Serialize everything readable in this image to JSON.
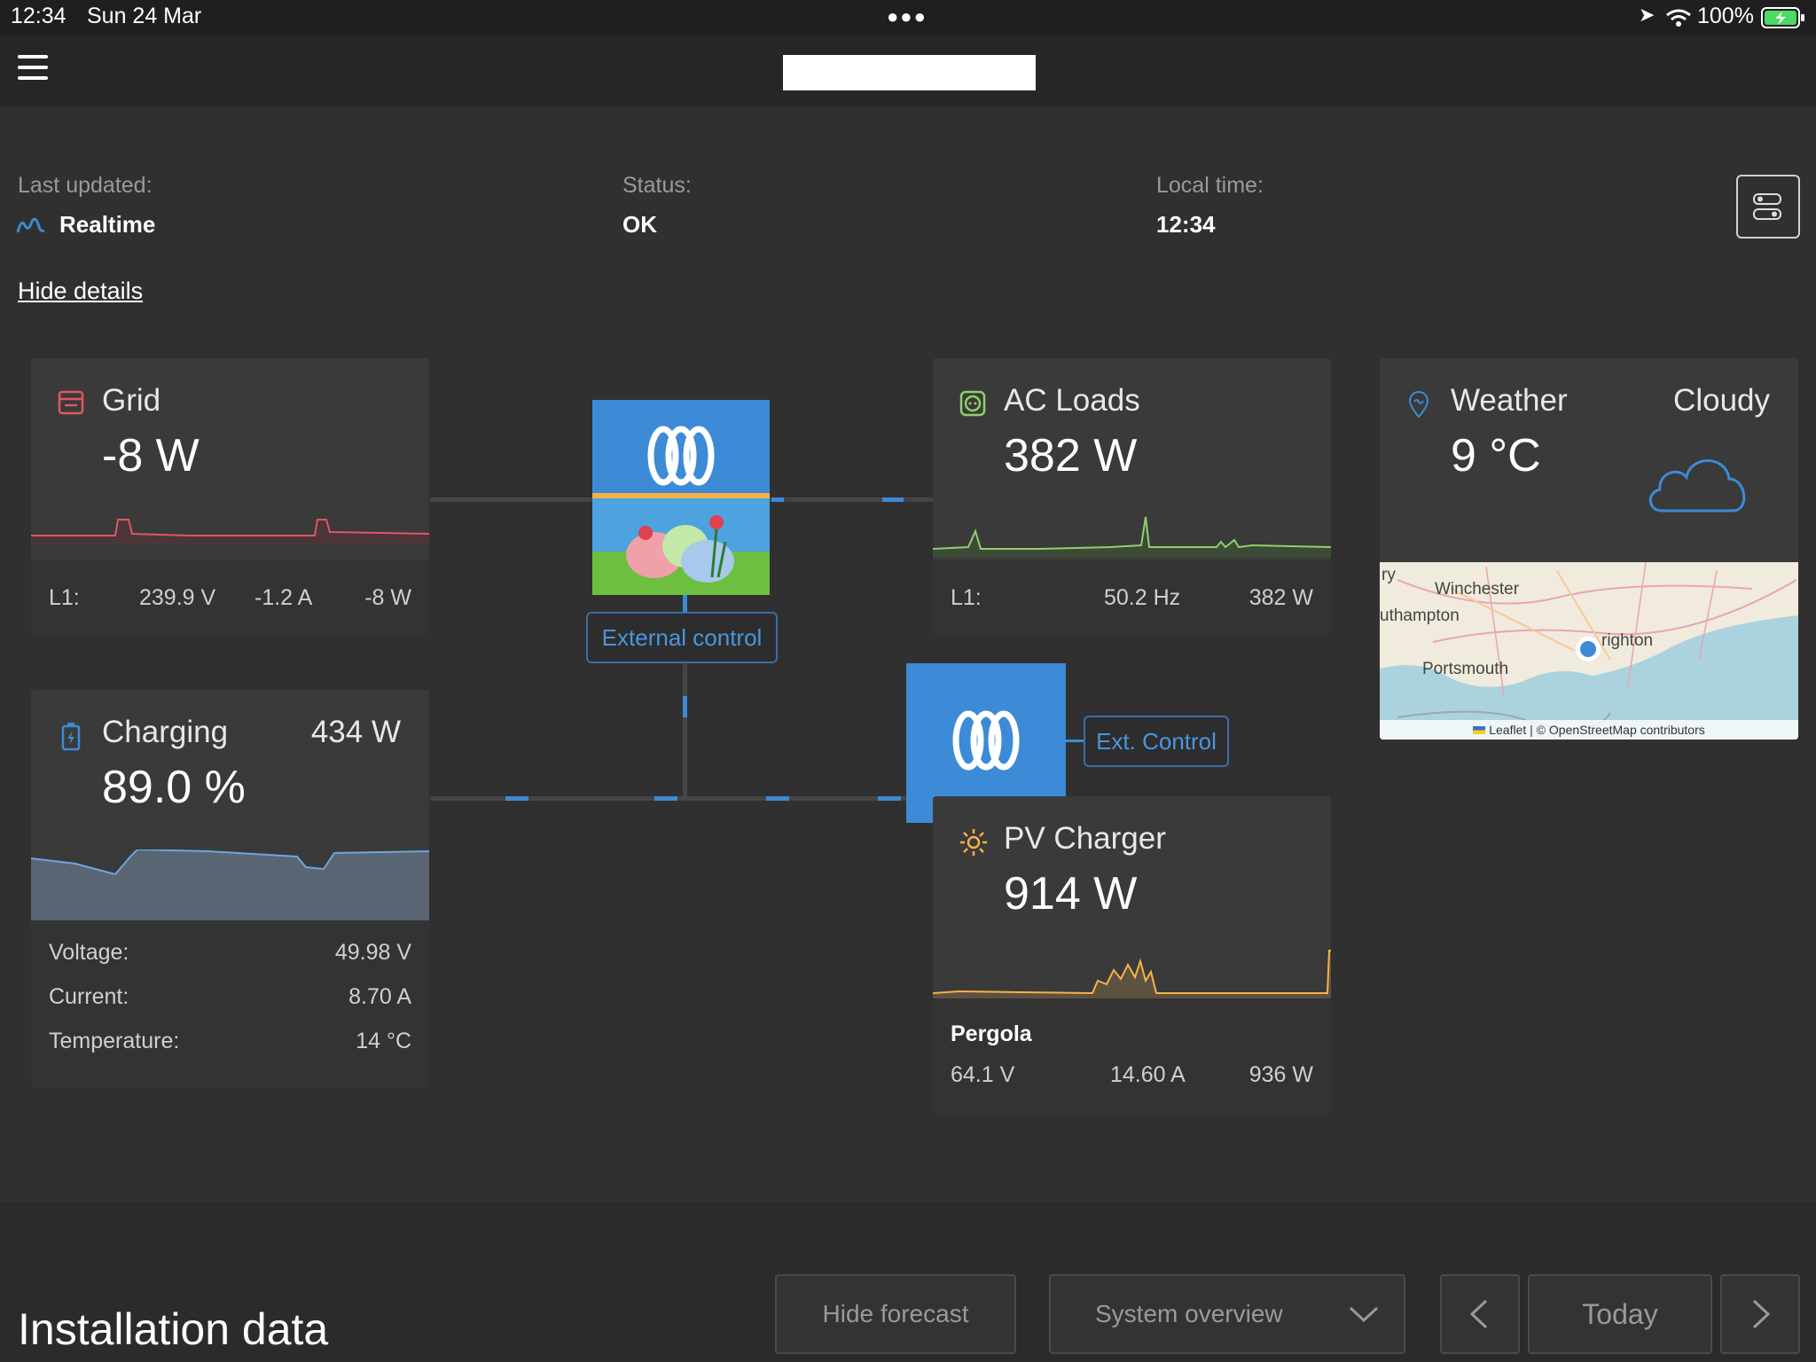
{
  "status_bar": {
    "time": "12:34",
    "date": "Sun 24 Mar",
    "battery": "100%"
  },
  "info": {
    "last_updated_label": "Last updated:",
    "last_updated_value": "Realtime",
    "status_label": "Status:",
    "status_value": "OK",
    "local_time_label": "Local time:",
    "local_time_value": "12:34",
    "hide_details": "Hide details"
  },
  "grid": {
    "title": "Grid",
    "power": "-8 W",
    "phase": "L1:",
    "voltage": "239.9 V",
    "current": "-1.2 A",
    "phase_power": "-8 W",
    "color": "#e0575f"
  },
  "battery": {
    "title": "Charging",
    "power": "434 W",
    "soc": "89.0 %",
    "rows": [
      {
        "label": "Voltage:",
        "value": "49.98 V"
      },
      {
        "label": "Current:",
        "value": "8.70 A"
      },
      {
        "label": "Temperature:",
        "value": "14 °C"
      }
    ]
  },
  "inverter": {
    "ext_label": "External control"
  },
  "ac_loads": {
    "title": "AC Loads",
    "power": "382 W",
    "phase": "L1:",
    "frequency": "50.2 Hz",
    "phase_power": "382 W",
    "color": "#8fd16a"
  },
  "solar_unit": {
    "ext_label": "Ext. Control"
  },
  "pv": {
    "title": "PV Charger",
    "power": "914 W",
    "name": "Pergola",
    "voltage": "64.1 V",
    "current": "14.60 A",
    "array_power": "936 W",
    "color": "#f5b248"
  },
  "weather": {
    "title": "Weather",
    "condition": "Cloudy",
    "temperature": "9 °C",
    "map_labels": [
      "Winchester",
      "uthampton",
      "righton",
      "Portsmouth",
      "ry"
    ],
    "attribution": "Leaflet | © OpenStreetMap contributors"
  },
  "bottom": {
    "heading": "Installation data",
    "hide_forecast": "Hide forecast",
    "view_select": "System overview",
    "today": "Today"
  },
  "colors": {
    "accent": "#3d8ad6",
    "bg": "#303030",
    "card": "#3a3a3a"
  }
}
